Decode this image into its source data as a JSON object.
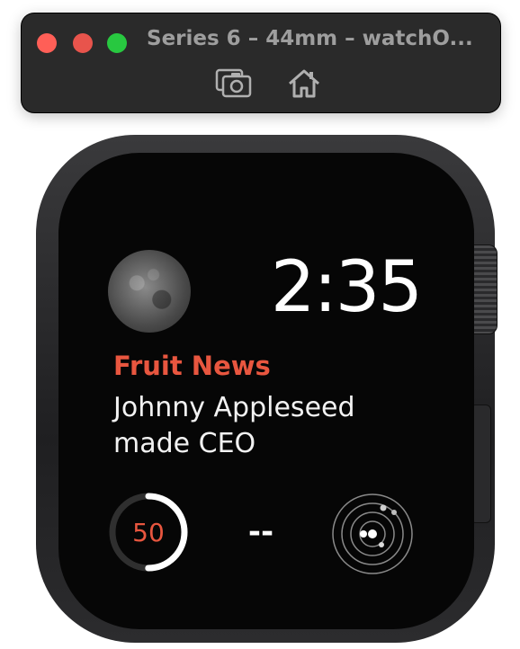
{
  "window": {
    "title": "Series 6 – 44mm – watchO...",
    "toolbar": {
      "screenshot_icon": "camera-icon",
      "home_icon": "home-icon"
    }
  },
  "watch_face": {
    "time": "2:35",
    "moon_icon": "moon-phase-icon",
    "news": {
      "source": "Fruit News",
      "headline": "Johnny Appleseed made CEO"
    },
    "ring_value": "50",
    "ring_progress": 0.5,
    "middle_complication": "--",
    "solar_icon": "solar-system-icon"
  },
  "colors": {
    "accent_red": "#e8563f",
    "close": "#ff5f57",
    "minimize": "#e8544c",
    "zoom": "#28c840"
  }
}
